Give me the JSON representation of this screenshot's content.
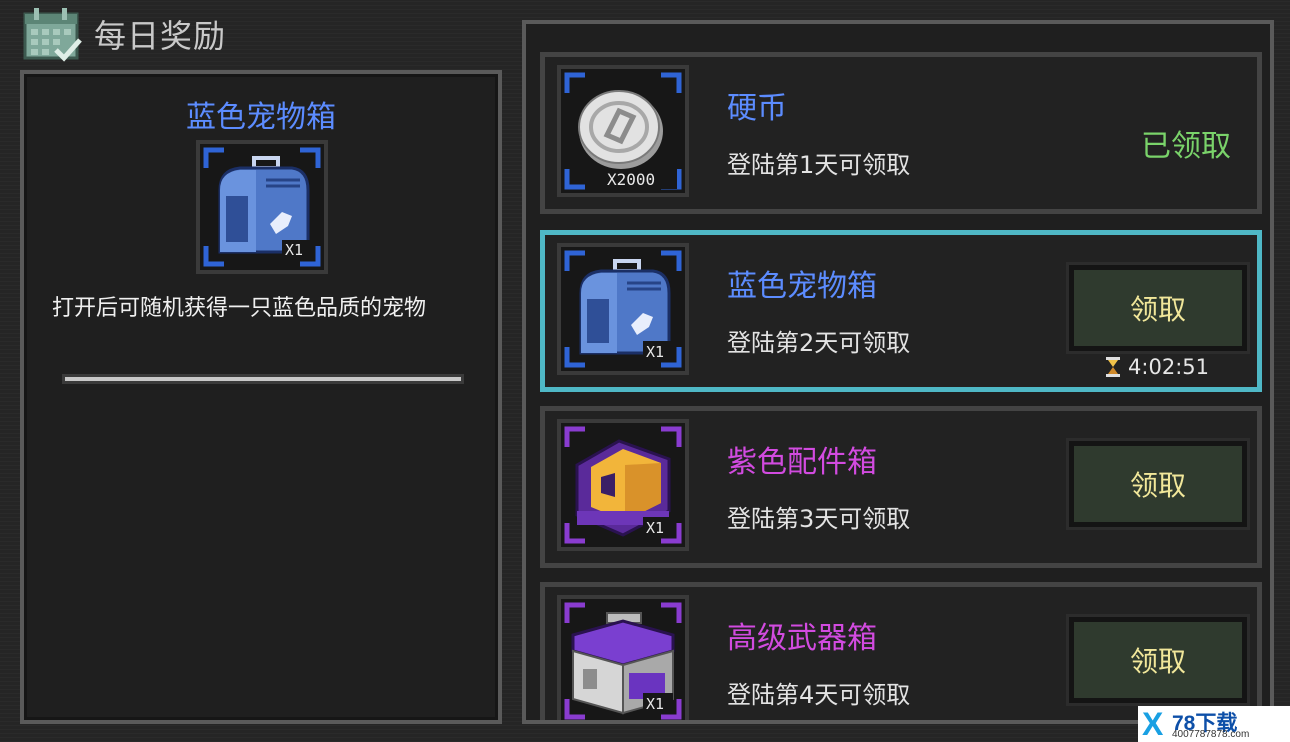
{
  "header": {
    "title": "每日奖励",
    "icon": "calendar-check-icon"
  },
  "detail": {
    "title": "蓝色宠物箱",
    "title_color": "#5c8cff",
    "icon": "blue-pet-crate-icon",
    "qty": "X1",
    "description": "打开后可随机获得一只蓝色品质的宠物"
  },
  "rewards": [
    {
      "name": "硬币",
      "name_color": "#5c8cff",
      "condition": "登陆第1天可领取",
      "icon": "silver-coin-icon",
      "qty": "X2000",
      "frame_color": "#2f64d6",
      "status": "已领取"
    },
    {
      "name": "蓝色宠物箱",
      "name_color": "#5c8cff",
      "condition": "登陆第2天可领取",
      "icon": "blue-pet-crate-icon",
      "qty": "X1",
      "frame_color": "#2f64d6",
      "button": "领取",
      "timer": "4:02:51"
    },
    {
      "name": "紫色配件箱",
      "name_color": "#d24be0",
      "condition": "登陆第3天可领取",
      "icon": "purple-parts-box-icon",
      "qty": "X1",
      "frame_color": "#8a3cd0",
      "button": "领取"
    },
    {
      "name": "高级武器箱",
      "name_color": "#d24be0",
      "condition": "登陆第4天可领取",
      "icon": "weapon-case-icon",
      "qty": "X1",
      "frame_color": "#8a3cd0",
      "button": "领取"
    }
  ],
  "watermark": {
    "mark": "X",
    "text": "78下载",
    "url": "4007787878.com"
  }
}
